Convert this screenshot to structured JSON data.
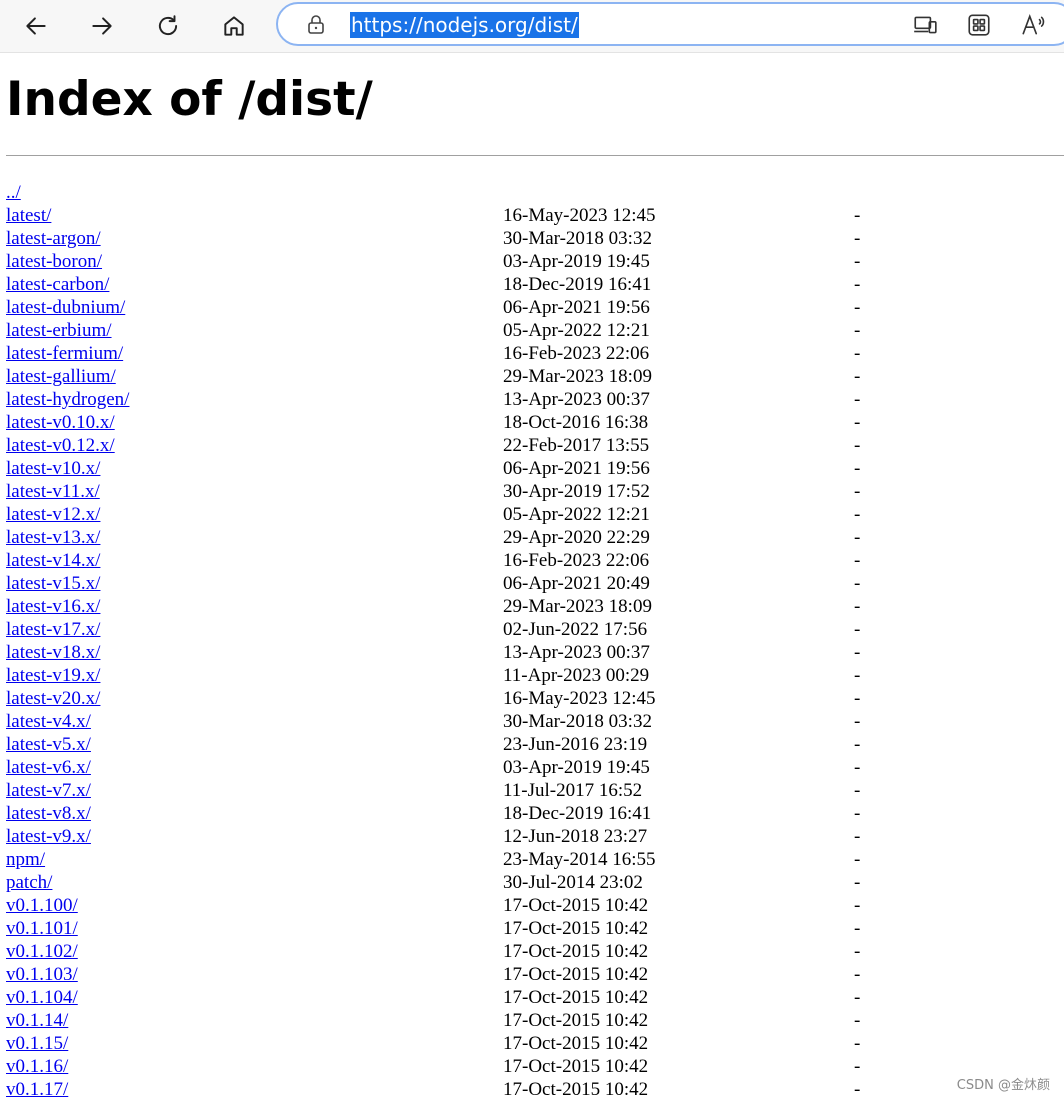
{
  "browser": {
    "url": "https://nodejs.org/dist/",
    "icons": [
      "back-arrow-icon",
      "forward-arrow-icon",
      "refresh-icon",
      "home-icon",
      "lock-icon",
      "devices-icon",
      "apps-grid-icon",
      "read-aloud-icon"
    ]
  },
  "page": {
    "heading": "Index of /dist/"
  },
  "entries": [
    {
      "name": "../",
      "date": "",
      "size": ""
    },
    {
      "name": "latest/",
      "date": "16-May-2023 12:45",
      "size": "-"
    },
    {
      "name": "latest-argon/",
      "date": "30-Mar-2018 03:32",
      "size": "-"
    },
    {
      "name": "latest-boron/",
      "date": "03-Apr-2019 19:45",
      "size": "-"
    },
    {
      "name": "latest-carbon/",
      "date": "18-Dec-2019 16:41",
      "size": "-"
    },
    {
      "name": "latest-dubnium/",
      "date": "06-Apr-2021 19:56",
      "size": "-"
    },
    {
      "name": "latest-erbium/",
      "date": "05-Apr-2022 12:21",
      "size": "-"
    },
    {
      "name": "latest-fermium/",
      "date": "16-Feb-2023 22:06",
      "size": "-"
    },
    {
      "name": "latest-gallium/",
      "date": "29-Mar-2023 18:09",
      "size": "-"
    },
    {
      "name": "latest-hydrogen/",
      "date": "13-Apr-2023 00:37",
      "size": "-"
    },
    {
      "name": "latest-v0.10.x/",
      "date": "18-Oct-2016 16:38",
      "size": "-"
    },
    {
      "name": "latest-v0.12.x/",
      "date": "22-Feb-2017 13:55",
      "size": "-"
    },
    {
      "name": "latest-v10.x/",
      "date": "06-Apr-2021 19:56",
      "size": "-"
    },
    {
      "name": "latest-v11.x/",
      "date": "30-Apr-2019 17:52",
      "size": "-"
    },
    {
      "name": "latest-v12.x/",
      "date": "05-Apr-2022 12:21",
      "size": "-"
    },
    {
      "name": "latest-v13.x/",
      "date": "29-Apr-2020 22:29",
      "size": "-"
    },
    {
      "name": "latest-v14.x/",
      "date": "16-Feb-2023 22:06",
      "size": "-"
    },
    {
      "name": "latest-v15.x/",
      "date": "06-Apr-2021 20:49",
      "size": "-"
    },
    {
      "name": "latest-v16.x/",
      "date": "29-Mar-2023 18:09",
      "size": "-"
    },
    {
      "name": "latest-v17.x/",
      "date": "02-Jun-2022 17:56",
      "size": "-"
    },
    {
      "name": "latest-v18.x/",
      "date": "13-Apr-2023 00:37",
      "size": "-"
    },
    {
      "name": "latest-v19.x/",
      "date": "11-Apr-2023 00:29",
      "size": "-"
    },
    {
      "name": "latest-v20.x/",
      "date": "16-May-2023 12:45",
      "size": "-"
    },
    {
      "name": "latest-v4.x/",
      "date": "30-Mar-2018 03:32",
      "size": "-"
    },
    {
      "name": "latest-v5.x/",
      "date": "23-Jun-2016 23:19",
      "size": "-"
    },
    {
      "name": "latest-v6.x/",
      "date": "03-Apr-2019 19:45",
      "size": "-"
    },
    {
      "name": "latest-v7.x/",
      "date": "11-Jul-2017 16:52",
      "size": "-"
    },
    {
      "name": "latest-v8.x/",
      "date": "18-Dec-2019 16:41",
      "size": "-"
    },
    {
      "name": "latest-v9.x/",
      "date": "12-Jun-2018 23:27",
      "size": "-"
    },
    {
      "name": "npm/",
      "date": "23-May-2014 16:55",
      "size": "-"
    },
    {
      "name": "patch/",
      "date": "30-Jul-2014 23:02",
      "size": "-"
    },
    {
      "name": "v0.1.100/",
      "date": "17-Oct-2015 10:42",
      "size": "-"
    },
    {
      "name": "v0.1.101/",
      "date": "17-Oct-2015 10:42",
      "size": "-"
    },
    {
      "name": "v0.1.102/",
      "date": "17-Oct-2015 10:42",
      "size": "-"
    },
    {
      "name": "v0.1.103/",
      "date": "17-Oct-2015 10:42",
      "size": "-"
    },
    {
      "name": "v0.1.104/",
      "date": "17-Oct-2015 10:42",
      "size": "-"
    },
    {
      "name": "v0.1.14/",
      "date": "17-Oct-2015 10:42",
      "size": "-"
    },
    {
      "name": "v0.1.15/",
      "date": "17-Oct-2015 10:42",
      "size": "-"
    },
    {
      "name": "v0.1.16/",
      "date": "17-Oct-2015 10:42",
      "size": "-"
    },
    {
      "name": "v0.1.17/",
      "date": "17-Oct-2015 10:42",
      "size": "-"
    }
  ],
  "watermark": "CSDN @金炑颜",
  "colors": {
    "link": "#0000ee",
    "url_highlight": "#1a73e8",
    "address_border": "#8cb4f2",
    "toolbar_bg": "#f7f7f7"
  }
}
